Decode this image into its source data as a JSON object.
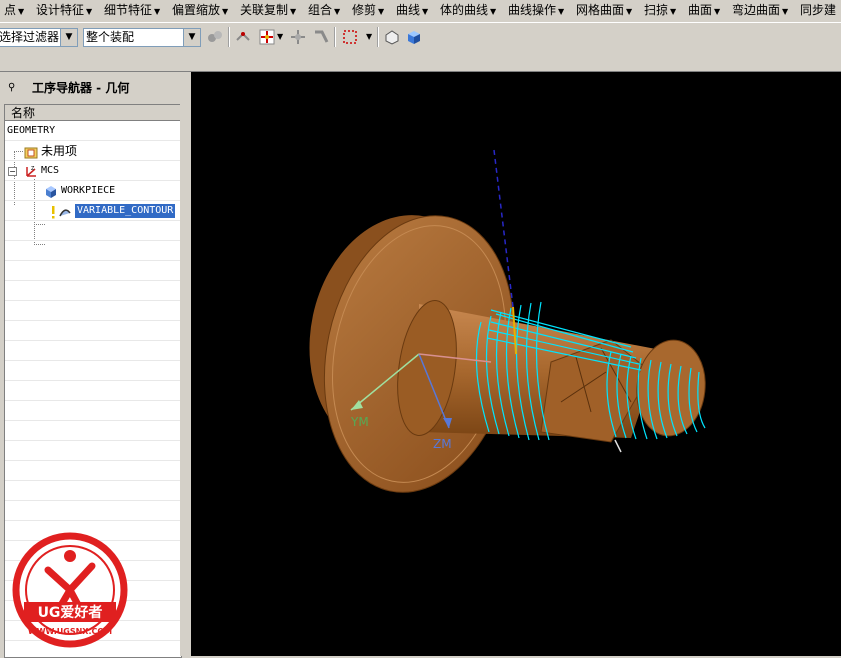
{
  "menubar": {
    "items": [
      "点",
      "设计特征",
      "细节特征",
      "偏置缩放",
      "关联复制",
      "组合",
      "修剪",
      "曲线",
      "体的曲线",
      "曲线操作",
      "网格曲面",
      "扫掠",
      "曲面",
      "弯边曲面",
      "同步建"
    ]
  },
  "toolbar": {
    "filter_value": "选择过滤器",
    "assembly_value": "整个装配"
  },
  "navigator": {
    "title": "工序导航器 - 几何",
    "column_header": "名称",
    "nodes": {
      "geometry": "GEOMETRY",
      "unused": "未用项",
      "mcs": "MCS",
      "workpiece": "WORKPIECE",
      "operation": "VARIABLE_CONTOUR"
    }
  },
  "viewport": {
    "axis_labels": {
      "ym": "YM",
      "zm": "ZM"
    }
  },
  "watermark": {
    "brand": "UG爱好者",
    "url": "WWW.UGSNX.COM"
  },
  "colors": {
    "part": "#a0622a",
    "toolpath": "#00e5ff",
    "background": "#000000",
    "selection": "#316ac5"
  }
}
